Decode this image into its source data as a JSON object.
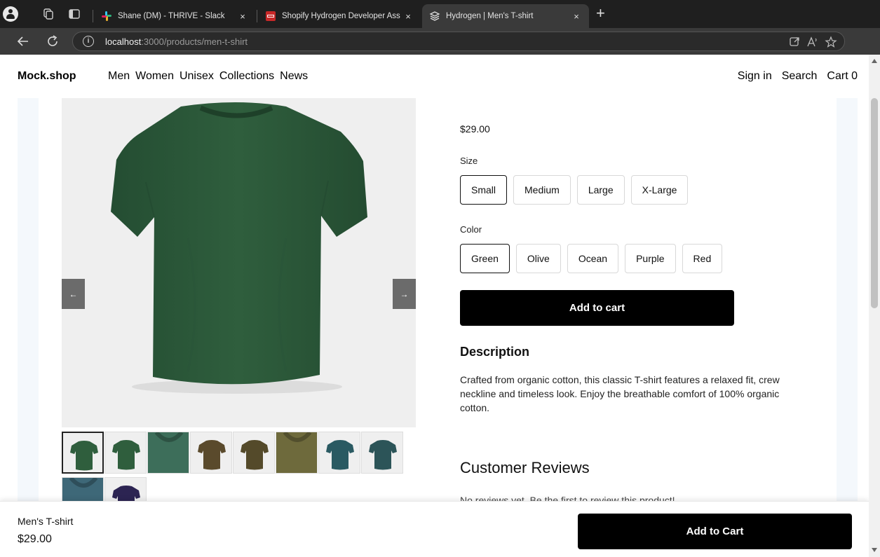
{
  "browser": {
    "tabs": [
      {
        "title": "Shane (DM) - THRIVE - Slack",
        "icon": "slack-icon",
        "close": "×"
      },
      {
        "title": "Shopify Hydrogen Developer Ass",
        "icon": "pdf-icon",
        "close": "×"
      },
      {
        "title": "Hydrogen | Men's T-shirt",
        "icon": "hydrogen-icon",
        "close": "×",
        "active": true
      }
    ],
    "new_tab": "+",
    "url_host": "localhost",
    "url_path": ":3000/products/men-t-shirt",
    "info_glyph": "i"
  },
  "header": {
    "logo": "Mock.shop",
    "nav": [
      "Men",
      "Women",
      "Unisex",
      "Collections",
      "News"
    ],
    "sign_in": "Sign in",
    "search": "Search",
    "cart": "Cart 0"
  },
  "gallery": {
    "prev": "←",
    "next": "→",
    "thumbnails": [
      {
        "color": "#2f5e3d",
        "style": "shirt",
        "selected": true
      },
      {
        "color": "#2f5e3d",
        "style": "shirt"
      },
      {
        "color": "#3d6e5a",
        "style": "closeup"
      },
      {
        "color": "#5a4a2c",
        "style": "shirt"
      },
      {
        "color": "#544a2a",
        "style": "shirt"
      },
      {
        "color": "#6e6a3c",
        "style": "closeup"
      },
      {
        "color": "#2a5a62",
        "style": "shirt"
      },
      {
        "color": "#2c5458",
        "style": "shirt"
      },
      {
        "color": "#3e6878",
        "style": "closeup"
      },
      {
        "color": "#2c2452",
        "style": "shirt"
      }
    ],
    "main_color": "#2f5e3d"
  },
  "product": {
    "price": "$29.00",
    "size_label": "Size",
    "sizes": [
      "Small",
      "Medium",
      "Large",
      "X-Large"
    ],
    "selected_size": "Small",
    "color_label": "Color",
    "colors": [
      "Green",
      "Olive",
      "Ocean",
      "Purple",
      "Red"
    ],
    "selected_color": "Green",
    "add_to_cart": "Add to cart",
    "description_title": "Description",
    "description": "Crafted from organic cotton, this classic T-shirt features a relaxed fit, crew neckline and timeless look. Enjoy the breathable comfort of 100% organic cotton.",
    "reviews_title": "Customer Reviews",
    "reviews_empty": "No reviews yet. Be the first to review this product!"
  },
  "sticky_bar": {
    "name": "Men's T-shirt",
    "price": "$29.00",
    "button": "Add to Cart"
  }
}
